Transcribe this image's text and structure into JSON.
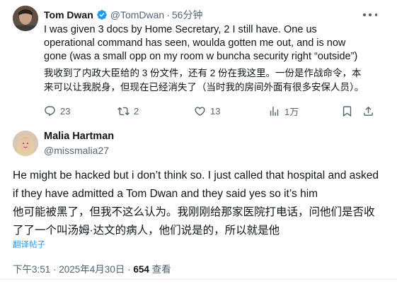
{
  "tweet": {
    "author_name": "Tom Dwan",
    "author_handle": "@TomDwan",
    "separator": "·",
    "time_ago": "56分钟",
    "text": "I was given 3 docs by Home Secretary, 2 I still have. One us operational command has seen, woulda gotten me out, and is now gone (was a small opp on my room w buncha security right “outside”)",
    "translation": "我收到了内政大臣给的 3 份文件，还有 2 份在我这里。一份是作战命令，本来可以让我脱身，但现在已经消失了（当时我的房间外面有很多安保人员）。",
    "stats": {
      "replies": "23",
      "retweets": "2",
      "likes": "13",
      "views": "1万"
    },
    "verified_color": "#1d9bf0"
  },
  "reply": {
    "author_name": "Malia Hartman",
    "author_handle": "@missmalia27",
    "text": "He might be hacked but i don’t think so. I just called that hospital and asked if they have admitted a Tom Dwan and they said yes so it’s him",
    "translation": "他可能被黑了，但我不这么认为。我刚刚给那家医院打电话，问他们是否收了了一个叫汤姆·达文的病人，他们说是的，所以就是他",
    "translate_link": "翻译帖子",
    "timestamp": "下午3:51 · 2025年4月30日 · ",
    "view_count": "654",
    "view_label": " 查看"
  },
  "colors": {
    "text": "#0f1419",
    "muted": "#536471",
    "accent": "#1d9bf0"
  }
}
